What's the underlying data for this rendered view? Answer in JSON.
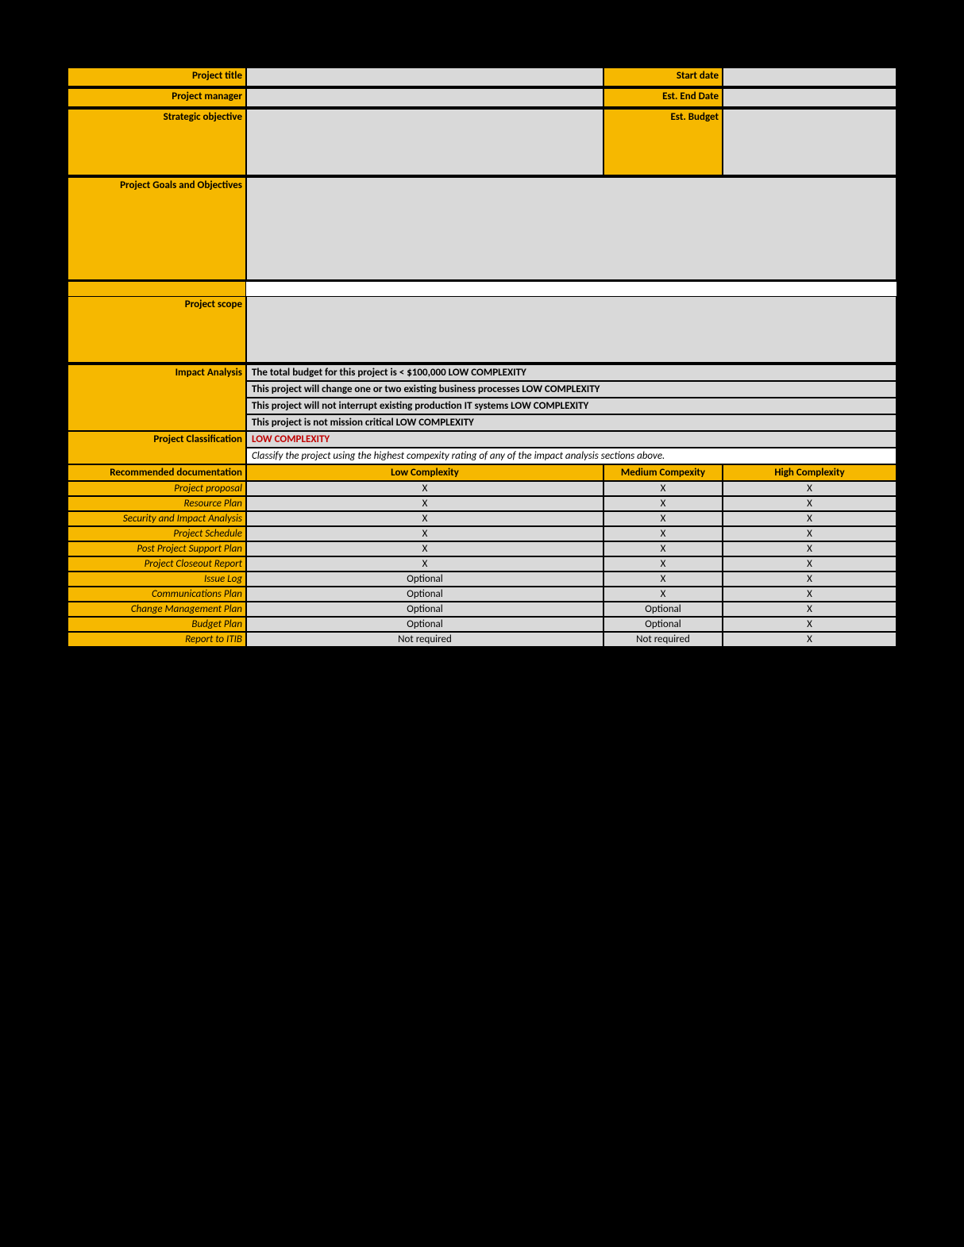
{
  "header": {
    "projectTitleLabel": "Project title",
    "startDateLabel": "Start date",
    "projectManagerLabel": "Project manager",
    "estEndDateLabel": "Est. End Date",
    "strategicObjectiveLabel": "Strategic objective",
    "estBudgetLabel": "Est. Budget",
    "goalsLabel": "Project Goals and Objectives",
    "scopeLabel": "Project scope",
    "impactLabel": "Impact Analysis",
    "classificationLabel": "Project Classification"
  },
  "impact": {
    "line1": "The total budget for this project is < $100,000 LOW COMPLEXITY",
    "line2": "This project will change one or two existing business processes LOW COMPLEXITY",
    "line3": "This project will not interrupt existing production IT systems LOW COMPLEXITY",
    "line4": "This project is not mission critical LOW COMPLEXITY"
  },
  "classification": {
    "value": "LOW COMPLEXITY",
    "note": "Classify the project using the highest compexity rating of any of the impact analysis sections above."
  },
  "docs": {
    "header0": "Recommended documentation",
    "header1": "Low Complexity",
    "header2": "Medium Compexity",
    "header3": "High Complexity",
    "rows": [
      {
        "label": "Project proposal",
        "low": "X",
        "med": "X",
        "high": "X"
      },
      {
        "label": "Resource Plan",
        "low": "X",
        "med": "X",
        "high": "X"
      },
      {
        "label": "Security and Impact Analysis",
        "low": "X",
        "med": "X",
        "high": "X"
      },
      {
        "label": "Project Schedule",
        "low": "X",
        "med": "X",
        "high": "X"
      },
      {
        "label": "Post Project Support Plan",
        "low": "X",
        "med": "X",
        "high": "X"
      },
      {
        "label": "Project Closeout Report",
        "low": "X",
        "med": "X",
        "high": "X"
      },
      {
        "label": "Issue Log",
        "low": "Optional",
        "med": "X",
        "high": "X"
      },
      {
        "label": "Communications Plan",
        "low": "Optional",
        "med": "X",
        "high": "X"
      },
      {
        "label": "Change Management Plan",
        "low": "Optional",
        "med": "Optional",
        "high": "X"
      },
      {
        "label": "Budget Plan",
        "low": "Optional",
        "med": "Optional",
        "high": "X"
      },
      {
        "label": "Report to ITIB",
        "low": "Not required",
        "med": "Not required",
        "high": "X"
      }
    ]
  }
}
